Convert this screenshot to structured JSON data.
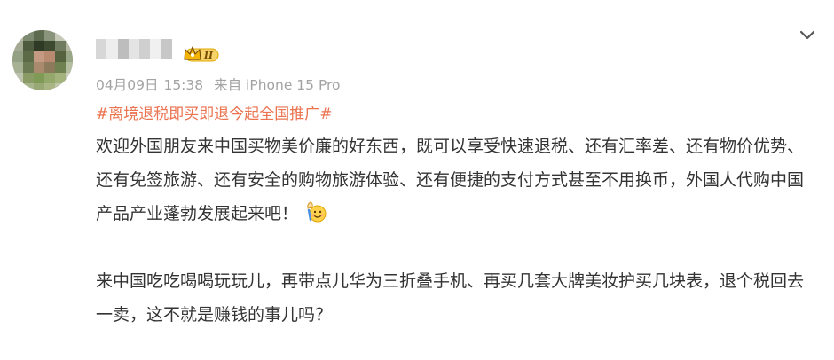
{
  "post": {
    "user": {
      "avatar_icon": "blurred-avatar",
      "name_icon": "blurred-username",
      "badge_icon": "member-level-2-crown-icon",
      "badge_text": "II"
    },
    "meta": {
      "date": "04月09日",
      "time": "15:38",
      "source": "来自 iPhone 15 Pro"
    },
    "expand_icon": "chevron-down-icon",
    "hashtag": "#离境退税即买即退今起全国推广#",
    "paragraphs": [
      "欢迎外国朋友来中国买物美价廉的好东西，既可以享受快速退税、还有汇率差、还有物价优势、还有免签旅游、还有安全的购物旅游体验、还有便捷的支付方式甚至不用换币，外国人代购中国产品产业蓬勃发展起来吧！",
      "来中国吃吃喝喝玩玩儿，再带点儿华为三折叠手机、再买几套大牌美妆护买几块表，退个税回去一卖，这不就是赚钱的事儿吗？"
    ],
    "emoji_icon": "waving-hand-emoji-icon"
  },
  "colors": {
    "hashtag": "#eb7350",
    "meta": "#a3a3a3",
    "text": "#333333",
    "badge_gold": "#f5b400"
  }
}
